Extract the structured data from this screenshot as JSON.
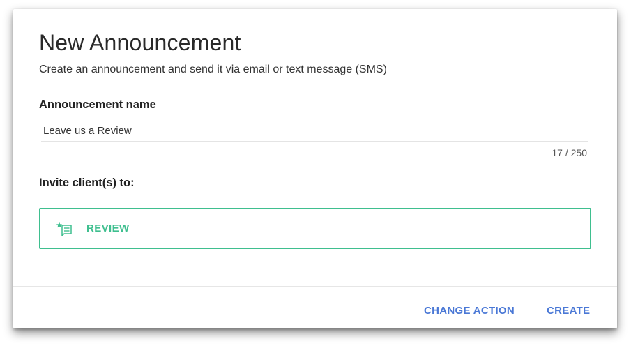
{
  "dialog": {
    "title": "New Announcement",
    "subtitle": "Create an announcement and send it via email or text message (SMS)"
  },
  "name_field": {
    "label": "Announcement name",
    "value": "Leave us a Review",
    "counter": "17 / 250"
  },
  "invite": {
    "label": "Invite client(s) to:",
    "action": {
      "label": "REVIEW",
      "icon": "review-star-list-icon"
    }
  },
  "footer": {
    "change_action_label": "CHANGE ACTION",
    "create_label": "CREATE"
  },
  "colors": {
    "accent_green": "#3fbf8f",
    "button_blue": "#4a78d6"
  }
}
